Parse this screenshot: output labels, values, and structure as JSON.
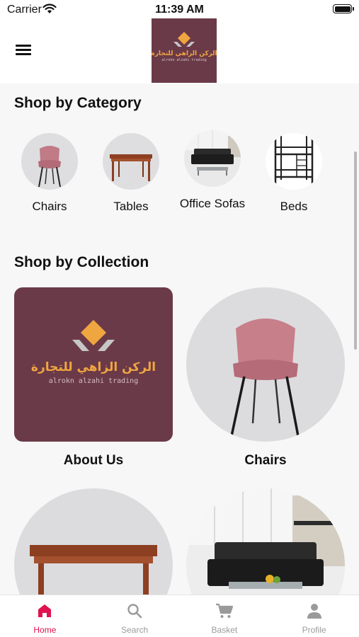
{
  "status_bar": {
    "carrier": "Carrier",
    "time": "11:39 AM"
  },
  "header": {
    "logo": {
      "arabic": "الركن الزاهي للتجارة",
      "latin": "alrokn alzahi trading"
    }
  },
  "categories": {
    "title": "Shop by Category",
    "items": [
      {
        "label": "Chairs"
      },
      {
        "label": "Tables"
      },
      {
        "label": "Office Sofas"
      },
      {
        "label": "Beds"
      }
    ]
  },
  "collections": {
    "title": "Shop by Collection",
    "items": [
      {
        "label": "About Us"
      },
      {
        "label": "Chairs"
      },
      {
        "label": ""
      },
      {
        "label": ""
      }
    ]
  },
  "tabs": [
    {
      "label": "Home",
      "active": true
    },
    {
      "label": "Search",
      "active": false
    },
    {
      "label": "Basket",
      "active": false
    },
    {
      "label": "Profile",
      "active": false
    }
  ],
  "colors": {
    "accent": "#e0124f",
    "brand": "#6b3a48",
    "logo_orange": "#f0a640"
  }
}
